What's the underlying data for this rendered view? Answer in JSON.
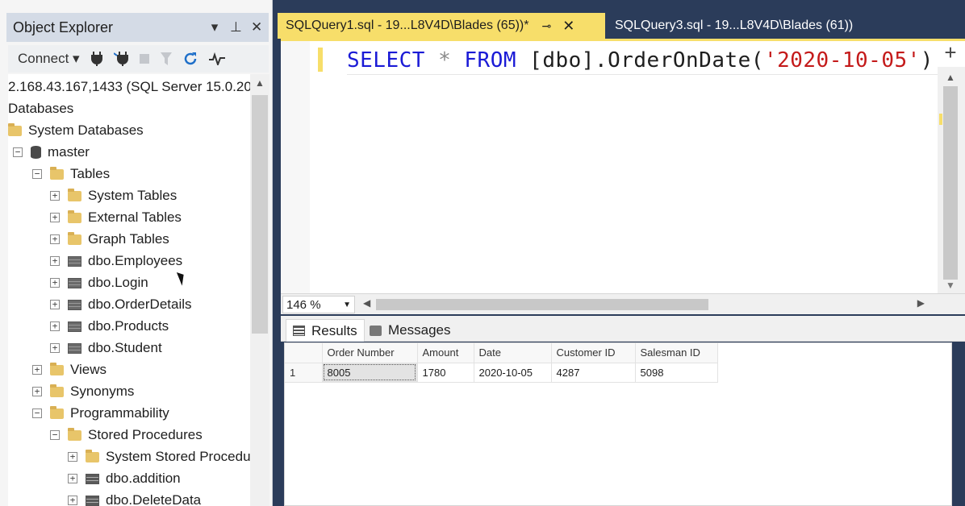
{
  "object_explorer": {
    "title": "Object Explorer",
    "title_tools": [
      "▾",
      "⊥",
      "✕"
    ],
    "toolbar": {
      "connect_label": "Connect ▾"
    },
    "tree": [
      {
        "text": "2.168.43.167,1433 (SQL Server 15.0.20",
        "icon": "server",
        "expander": ""
      },
      {
        "text": "Databases",
        "icon": "none",
        "expander": ""
      },
      {
        "text": "System Databases",
        "icon": "folder",
        "expander": ""
      },
      {
        "text": "master",
        "icon": "database",
        "expander": "−"
      },
      {
        "text": "Tables",
        "icon": "folder",
        "expander": "−"
      },
      {
        "text": "System Tables",
        "icon": "folder",
        "expander": "+"
      },
      {
        "text": "External Tables",
        "icon": "folder",
        "expander": "+"
      },
      {
        "text": "Graph Tables",
        "icon": "folder",
        "expander": "+"
      },
      {
        "text": "dbo.Employees",
        "icon": "table",
        "expander": "+"
      },
      {
        "text": "dbo.Login",
        "icon": "table",
        "expander": "+"
      },
      {
        "text": "dbo.OrderDetails",
        "icon": "table",
        "expander": "+"
      },
      {
        "text": "dbo.Products",
        "icon": "table",
        "expander": "+"
      },
      {
        "text": "dbo.Student",
        "icon": "table",
        "expander": "+"
      },
      {
        "text": "Views",
        "icon": "folder",
        "expander": "+"
      },
      {
        "text": "Synonyms",
        "icon": "folder",
        "expander": "+"
      },
      {
        "text": "Programmability",
        "icon": "folder",
        "expander": "−"
      },
      {
        "text": "Stored Procedures",
        "icon": "folder",
        "expander": "−"
      },
      {
        "text": "System Stored Procedu",
        "icon": "folder",
        "expander": "+"
      },
      {
        "text": "dbo.addition",
        "icon": "proc",
        "expander": "+"
      },
      {
        "text": "dbo.DeleteData",
        "icon": "proc",
        "expander": "+"
      }
    ]
  },
  "editor": {
    "tabs": [
      {
        "label": "SQLQuery1.sql - 19...L8V4D\\Blades (65))*",
        "pin": "⊸",
        "close": "✕"
      },
      {
        "label": "SQLQuery3.sql - 19...L8V4D\\Blades (61))"
      }
    ],
    "code": {
      "kw1": "SELECT",
      "star": "*",
      "kw2": "FROM",
      "schema": "[dbo].OrderOnDate(",
      "literal": "'2020-10-05'",
      "close": ")"
    },
    "zoom": "146 %"
  },
  "results": {
    "tabs": [
      "Results",
      "Messages"
    ],
    "columns": [
      "Order Number",
      "Amount",
      "Date",
      "Customer ID",
      "Salesman ID"
    ],
    "rows": [
      {
        "row": "1",
        "cells": [
          "8005",
          "1780",
          "2020-10-05",
          "4287",
          "5098"
        ]
      }
    ]
  }
}
